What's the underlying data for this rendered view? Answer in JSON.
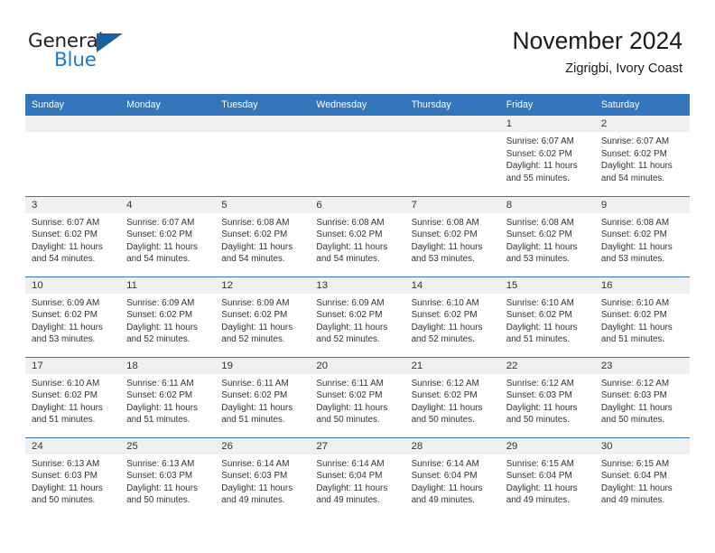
{
  "brand": {
    "name_part1": "General",
    "name_part2": "Blue",
    "triangle_color": "#18639f",
    "blue_color": "#1f7bc1"
  },
  "header": {
    "title": "November 2024",
    "subtitle": "Zigrigbi, Ivory Coast"
  },
  "theme": {
    "header_row_bg": "#3376bb",
    "daynum_band_bg": "#f0f0f0",
    "text_color": "#333333"
  },
  "weekdays": [
    "Sunday",
    "Monday",
    "Tuesday",
    "Wednesday",
    "Thursday",
    "Friday",
    "Saturday"
  ],
  "weeks": [
    [
      {
        "day": "",
        "lines": []
      },
      {
        "day": "",
        "lines": []
      },
      {
        "day": "",
        "lines": []
      },
      {
        "day": "",
        "lines": []
      },
      {
        "day": "",
        "lines": []
      },
      {
        "day": "1",
        "lines": [
          "Sunrise: 6:07 AM",
          "Sunset: 6:02 PM",
          "Daylight: 11 hours",
          "and 55 minutes."
        ]
      },
      {
        "day": "2",
        "lines": [
          "Sunrise: 6:07 AM",
          "Sunset: 6:02 PM",
          "Daylight: 11 hours",
          "and 54 minutes."
        ]
      }
    ],
    [
      {
        "day": "3",
        "lines": [
          "Sunrise: 6:07 AM",
          "Sunset: 6:02 PM",
          "Daylight: 11 hours",
          "and 54 minutes."
        ]
      },
      {
        "day": "4",
        "lines": [
          "Sunrise: 6:07 AM",
          "Sunset: 6:02 PM",
          "Daylight: 11 hours",
          "and 54 minutes."
        ]
      },
      {
        "day": "5",
        "lines": [
          "Sunrise: 6:08 AM",
          "Sunset: 6:02 PM",
          "Daylight: 11 hours",
          "and 54 minutes."
        ]
      },
      {
        "day": "6",
        "lines": [
          "Sunrise: 6:08 AM",
          "Sunset: 6:02 PM",
          "Daylight: 11 hours",
          "and 54 minutes."
        ]
      },
      {
        "day": "7",
        "lines": [
          "Sunrise: 6:08 AM",
          "Sunset: 6:02 PM",
          "Daylight: 11 hours",
          "and 53 minutes."
        ]
      },
      {
        "day": "8",
        "lines": [
          "Sunrise: 6:08 AM",
          "Sunset: 6:02 PM",
          "Daylight: 11 hours",
          "and 53 minutes."
        ]
      },
      {
        "day": "9",
        "lines": [
          "Sunrise: 6:08 AM",
          "Sunset: 6:02 PM",
          "Daylight: 11 hours",
          "and 53 minutes."
        ]
      }
    ],
    [
      {
        "day": "10",
        "lines": [
          "Sunrise: 6:09 AM",
          "Sunset: 6:02 PM",
          "Daylight: 11 hours",
          "and 53 minutes."
        ]
      },
      {
        "day": "11",
        "lines": [
          "Sunrise: 6:09 AM",
          "Sunset: 6:02 PM",
          "Daylight: 11 hours",
          "and 52 minutes."
        ]
      },
      {
        "day": "12",
        "lines": [
          "Sunrise: 6:09 AM",
          "Sunset: 6:02 PM",
          "Daylight: 11 hours",
          "and 52 minutes."
        ]
      },
      {
        "day": "13",
        "lines": [
          "Sunrise: 6:09 AM",
          "Sunset: 6:02 PM",
          "Daylight: 11 hours",
          "and 52 minutes."
        ]
      },
      {
        "day": "14",
        "lines": [
          "Sunrise: 6:10 AM",
          "Sunset: 6:02 PM",
          "Daylight: 11 hours",
          "and 52 minutes."
        ]
      },
      {
        "day": "15",
        "lines": [
          "Sunrise: 6:10 AM",
          "Sunset: 6:02 PM",
          "Daylight: 11 hours",
          "and 51 minutes."
        ]
      },
      {
        "day": "16",
        "lines": [
          "Sunrise: 6:10 AM",
          "Sunset: 6:02 PM",
          "Daylight: 11 hours",
          "and 51 minutes."
        ]
      }
    ],
    [
      {
        "day": "17",
        "lines": [
          "Sunrise: 6:10 AM",
          "Sunset: 6:02 PM",
          "Daylight: 11 hours",
          "and 51 minutes."
        ]
      },
      {
        "day": "18",
        "lines": [
          "Sunrise: 6:11 AM",
          "Sunset: 6:02 PM",
          "Daylight: 11 hours",
          "and 51 minutes."
        ]
      },
      {
        "day": "19",
        "lines": [
          "Sunrise: 6:11 AM",
          "Sunset: 6:02 PM",
          "Daylight: 11 hours",
          "and 51 minutes."
        ]
      },
      {
        "day": "20",
        "lines": [
          "Sunrise: 6:11 AM",
          "Sunset: 6:02 PM",
          "Daylight: 11 hours",
          "and 50 minutes."
        ]
      },
      {
        "day": "21",
        "lines": [
          "Sunrise: 6:12 AM",
          "Sunset: 6:02 PM",
          "Daylight: 11 hours",
          "and 50 minutes."
        ]
      },
      {
        "day": "22",
        "lines": [
          "Sunrise: 6:12 AM",
          "Sunset: 6:03 PM",
          "Daylight: 11 hours",
          "and 50 minutes."
        ]
      },
      {
        "day": "23",
        "lines": [
          "Sunrise: 6:12 AM",
          "Sunset: 6:03 PM",
          "Daylight: 11 hours",
          "and 50 minutes."
        ]
      }
    ],
    [
      {
        "day": "24",
        "lines": [
          "Sunrise: 6:13 AM",
          "Sunset: 6:03 PM",
          "Daylight: 11 hours",
          "and 50 minutes."
        ]
      },
      {
        "day": "25",
        "lines": [
          "Sunrise: 6:13 AM",
          "Sunset: 6:03 PM",
          "Daylight: 11 hours",
          "and 50 minutes."
        ]
      },
      {
        "day": "26",
        "lines": [
          "Sunrise: 6:14 AM",
          "Sunset: 6:03 PM",
          "Daylight: 11 hours",
          "and 49 minutes."
        ]
      },
      {
        "day": "27",
        "lines": [
          "Sunrise: 6:14 AM",
          "Sunset: 6:04 PM",
          "Daylight: 11 hours",
          "and 49 minutes."
        ]
      },
      {
        "day": "28",
        "lines": [
          "Sunrise: 6:14 AM",
          "Sunset: 6:04 PM",
          "Daylight: 11 hours",
          "and 49 minutes."
        ]
      },
      {
        "day": "29",
        "lines": [
          "Sunrise: 6:15 AM",
          "Sunset: 6:04 PM",
          "Daylight: 11 hours",
          "and 49 minutes."
        ]
      },
      {
        "day": "30",
        "lines": [
          "Sunrise: 6:15 AM",
          "Sunset: 6:04 PM",
          "Daylight: 11 hours",
          "and 49 minutes."
        ]
      }
    ]
  ]
}
